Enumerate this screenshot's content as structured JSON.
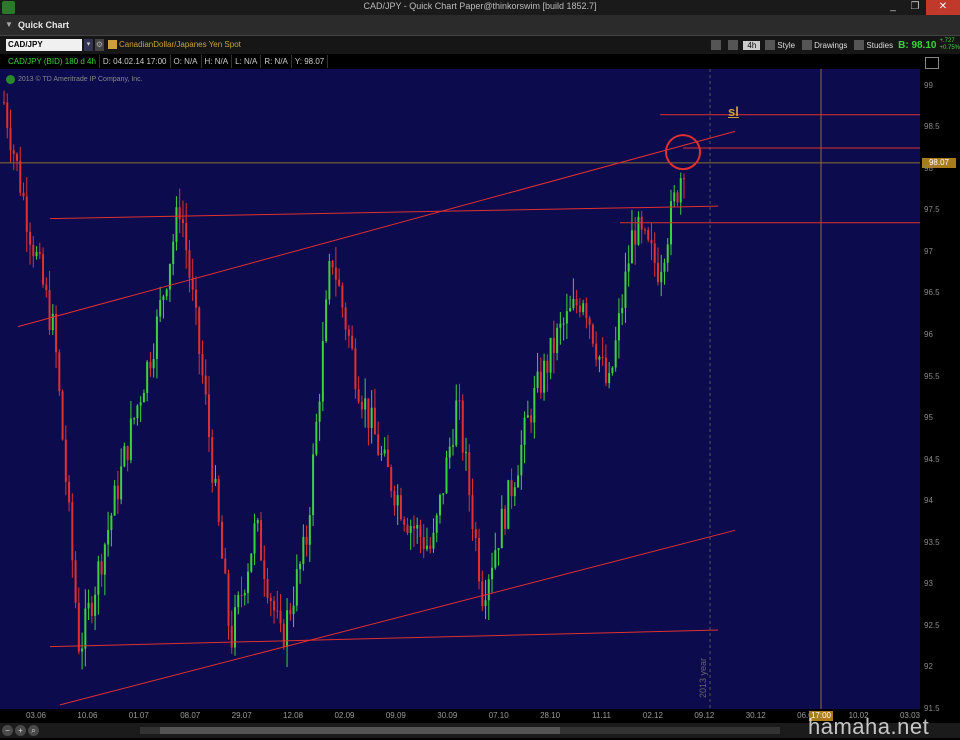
{
  "window": {
    "title": "CAD/JPY - Quick Chart Paper@thinkorswim [build 1852.7]",
    "min": "_",
    "max": "❐",
    "close": "✕"
  },
  "panel": {
    "title": "Quick Chart"
  },
  "toolbar": {
    "symbol": "CAD/JPY",
    "description": "CanadianDollar/Japanes Yen Spot",
    "timeframe": "4h",
    "style": "Style",
    "drawings": "Drawings",
    "studies": "Studies",
    "bid": "B: 98.10",
    "change1": "+.727",
    "change2": "+0.75%"
  },
  "infobar": {
    "label": "CAD/JPY (BID) 180 d 4h",
    "date": "D: 04.02.14 17:00",
    "open": "O: N/A",
    "high": "H: N/A",
    "low": "L: N/A",
    "range": "R: N/A",
    "y": "Y: 98.07"
  },
  "chart": {
    "copyright": "2013 © TD Ameritrade IP Company, Inc.",
    "sl_label": "sl",
    "year_label": "2013 year",
    "current_price": "98.07",
    "cursor_time": "17:00",
    "colors": {
      "background": "#0c0b4e",
      "up": "#3cd23c",
      "down": "#e03030",
      "line": "#e03030"
    }
  },
  "watermark": "hamaha.net",
  "chart_data": {
    "type": "line",
    "title": "CAD/JPY (BID) 180 d 4h",
    "ylim": [
      91.5,
      99.2
    ],
    "y_ticks": [
      "99",
      "98.5",
      "98",
      "97.5",
      "97",
      "96.5",
      "96",
      "95.5",
      "95",
      "94.5",
      "94",
      "93.5",
      "93",
      "92.5",
      "92",
      "91.5"
    ],
    "x_ticks": [
      "03.06",
      "10.06",
      "01.07",
      "08.07",
      "29.07",
      "12.08",
      "02.09",
      "09.09",
      "30.09",
      "07.10",
      "28.10",
      "11.11",
      "02.12",
      "09.12",
      "30.12",
      "06.01",
      "10.02",
      "03.03"
    ],
    "series": [
      {
        "values": [
          98.8,
          97.3,
          96.0,
          92.2,
          93.5,
          94.8,
          96.0,
          97.6,
          95.2,
          92.3,
          93.7,
          92.3,
          93.5,
          97.0,
          95.5,
          94.5,
          93.8,
          93.4,
          95.2,
          92.9,
          94.0,
          95.2,
          96.0,
          96.5,
          95.3,
          97.3,
          96.8,
          98.1
        ]
      }
    ]
  }
}
